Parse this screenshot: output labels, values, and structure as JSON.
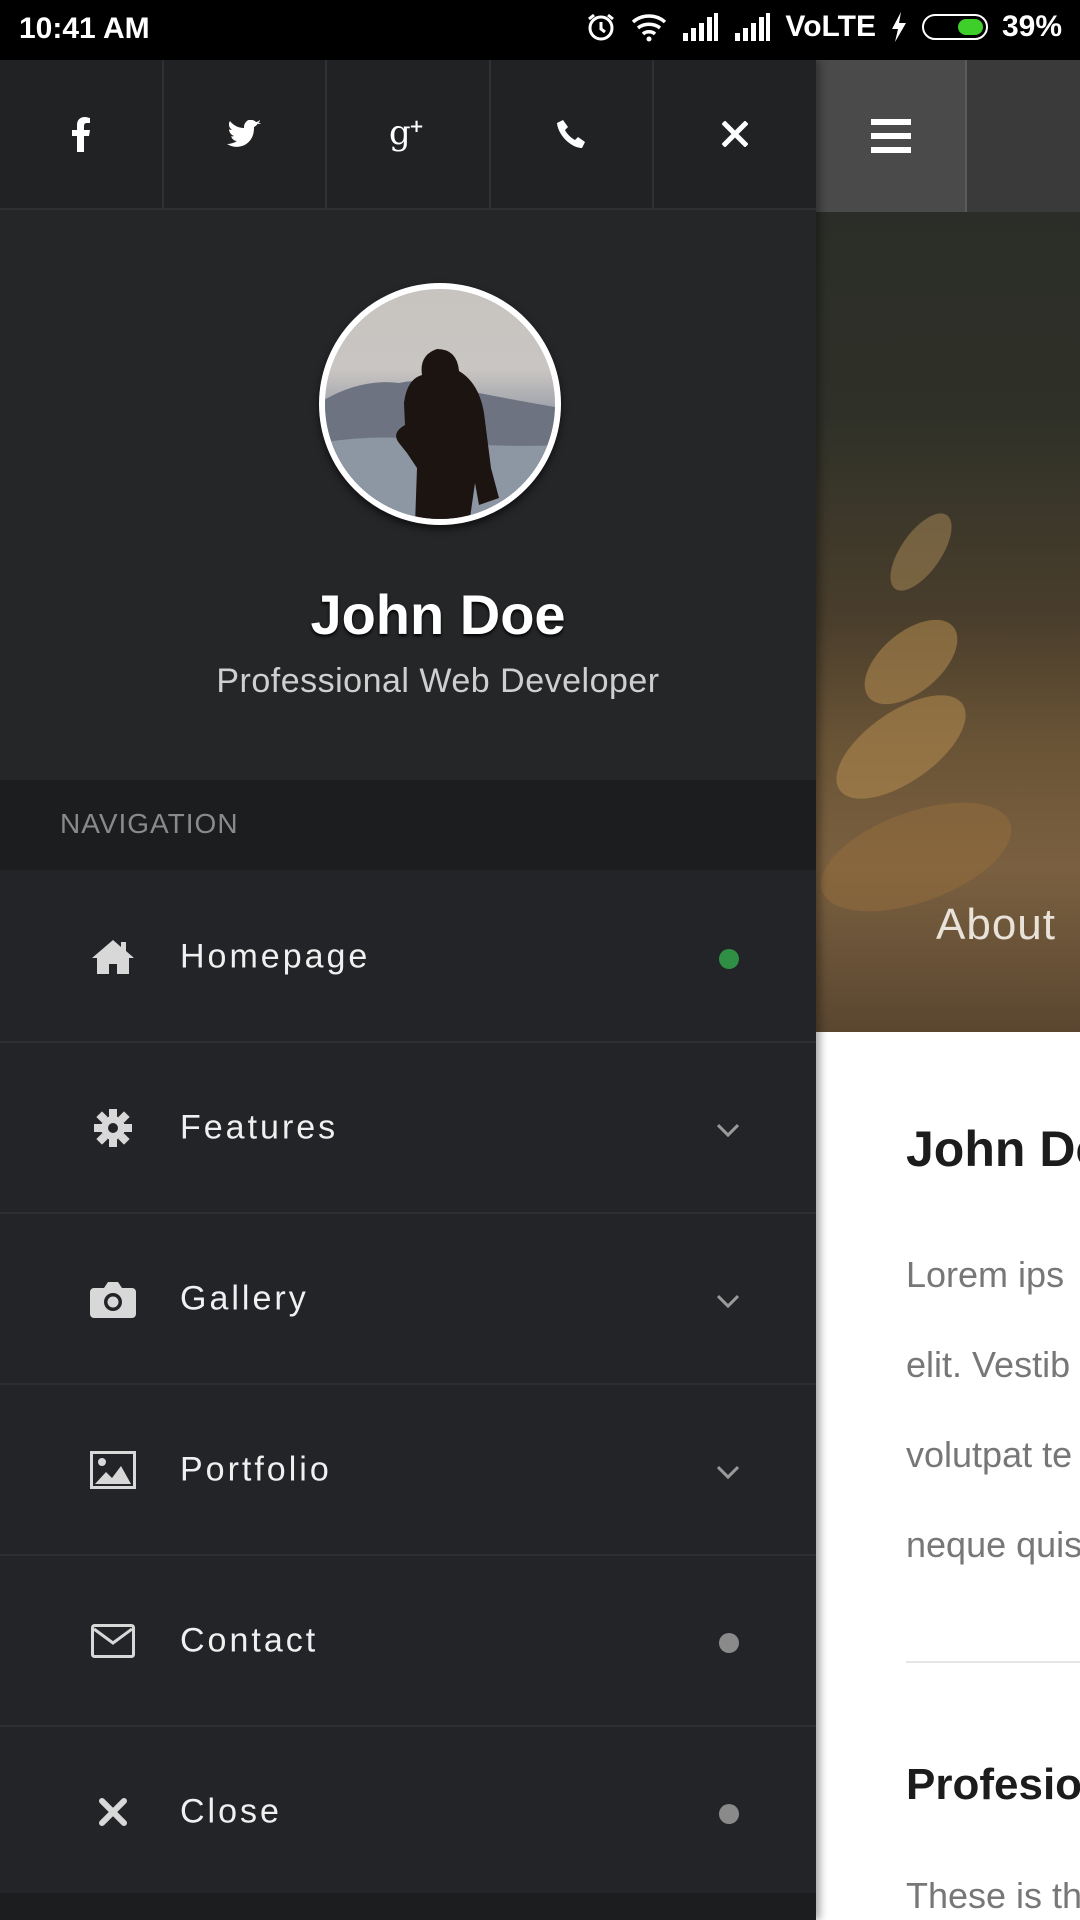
{
  "status_bar": {
    "time": "10:41 AM",
    "network": "VoLTE",
    "battery": "39%",
    "battery_level": 0.39
  },
  "social": {
    "items": [
      {
        "name": "facebook-icon"
      },
      {
        "name": "twitter-icon"
      },
      {
        "name": "google-plus-icon"
      },
      {
        "name": "phone-icon"
      },
      {
        "name": "close-icon"
      }
    ]
  },
  "profile": {
    "name": "John Doe",
    "role": "Professional Web Developer"
  },
  "navigation": {
    "header": "NAVIGATION",
    "items": [
      {
        "label": "Homepage",
        "icon": "home-icon",
        "indicator": "dot-active"
      },
      {
        "label": "Features",
        "icon": "gear-icon",
        "indicator": "chevron"
      },
      {
        "label": "Gallery",
        "icon": "camera-icon",
        "indicator": "chevron"
      },
      {
        "label": "Portfolio",
        "icon": "image-icon",
        "indicator": "chevron"
      },
      {
        "label": "Contact",
        "icon": "envelope-icon",
        "indicator": "dot"
      },
      {
        "label": "Close",
        "icon": "close-icon",
        "indicator": "dot"
      }
    ],
    "active_color": "#2f8f44"
  },
  "content": {
    "hero_label": "About",
    "heading": "John Do",
    "paragraph_lines": [
      "Lorem ips",
      "elit. Vestib",
      "volutpat te",
      "neque quis"
    ],
    "heading2": "Profesion",
    "paragraph2": "These is th"
  }
}
